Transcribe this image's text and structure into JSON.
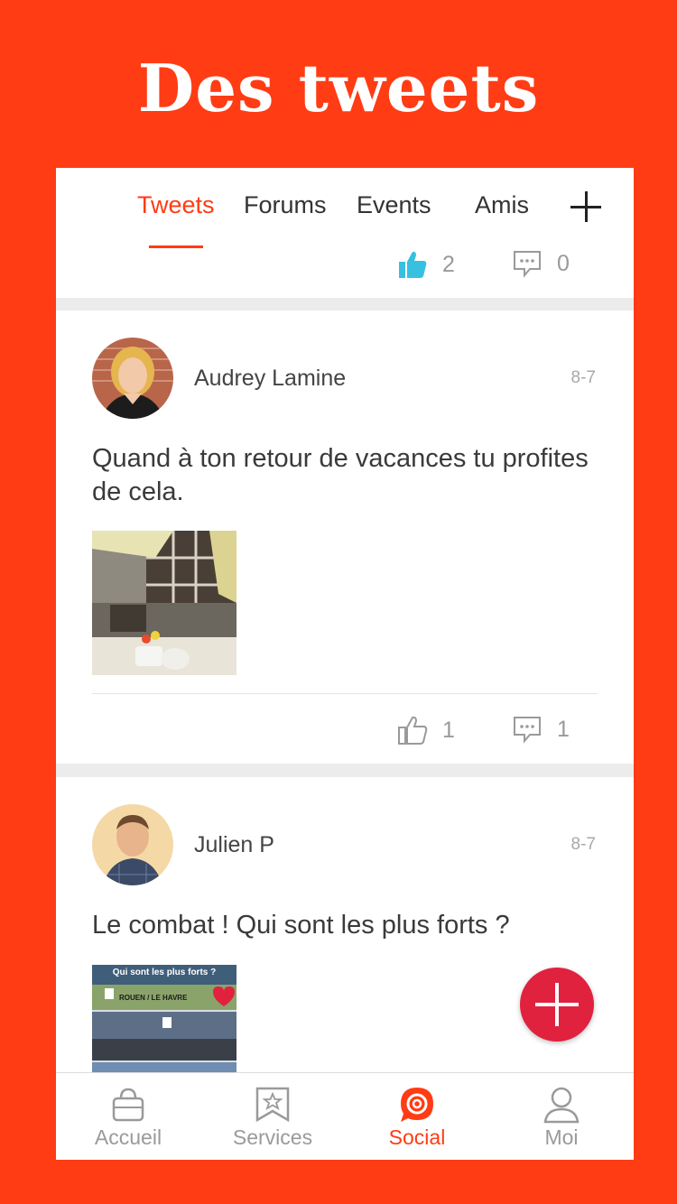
{
  "headline": "Des tweets",
  "tabs": [
    {
      "label": "Tweets",
      "active": true
    },
    {
      "label": "Forums",
      "active": false
    },
    {
      "label": "Events",
      "active": false
    },
    {
      "label": "Amis",
      "active": false
    }
  ],
  "top_stats": {
    "likes": "2",
    "comments": "0"
  },
  "posts": [
    {
      "author": "Audrey Lamine",
      "date": "8-7",
      "text": "Quand à ton retour de vacances tu profites de cela.",
      "likes": "1",
      "comments": "1"
    },
    {
      "author": "Julien P",
      "date": "8-7",
      "text": "Le combat ! Qui sont les plus forts ?",
      "image_text": {
        "line1": "Qui sont les plus forts ?",
        "line2": "ROUEN / LE HAVRE"
      }
    }
  ],
  "bottom_nav": [
    {
      "label": "Accueil",
      "icon": "basket-icon",
      "active": false
    },
    {
      "label": "Services",
      "icon": "bookmark-star-icon",
      "active": false
    },
    {
      "label": "Social",
      "icon": "chat-target-icon",
      "active": true
    },
    {
      "label": "Moi",
      "icon": "person-icon",
      "active": false
    }
  ],
  "colors": {
    "brand": "#ff3c14",
    "fab": "#e0223f",
    "like_active": "#38c0e0"
  }
}
